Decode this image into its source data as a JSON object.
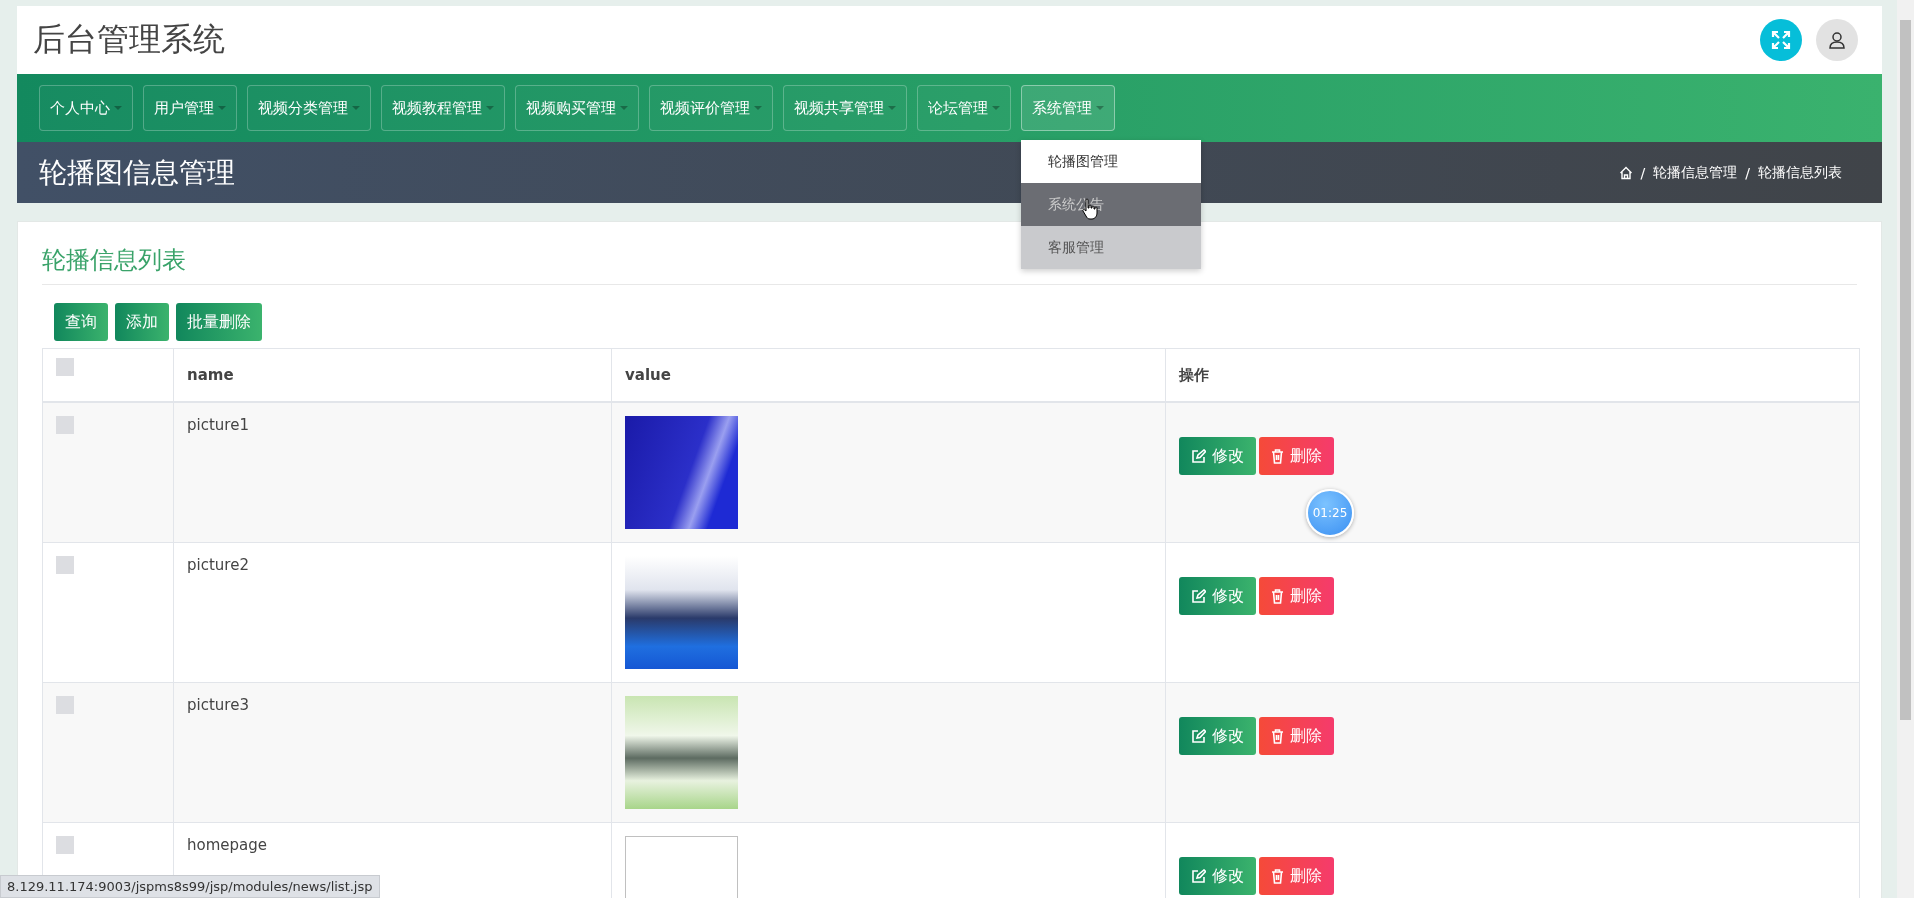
{
  "app_title": "后台管理系统",
  "nav": [
    {
      "label": "个人中心"
    },
    {
      "label": "用户管理"
    },
    {
      "label": "视频分类管理"
    },
    {
      "label": "视频教程管理"
    },
    {
      "label": "视频购买管理"
    },
    {
      "label": "视频评价管理"
    },
    {
      "label": "视频共享管理"
    },
    {
      "label": "论坛管理"
    },
    {
      "label": "系统管理",
      "expanded": true
    }
  ],
  "dropdown": [
    {
      "label": "轮播图管理",
      "kind": "current"
    },
    {
      "label": "系统公告",
      "kind": "hover"
    },
    {
      "label": "客服管理",
      "kind": "plain"
    }
  ],
  "page_title": "轮播图信息管理",
  "breadcrumb": [
    {
      "sep": "/",
      "label": "轮播信息管理"
    },
    {
      "sep": "/",
      "label": "轮播信息列表"
    }
  ],
  "card_title": "轮播信息列表",
  "toolbar": [
    "查询",
    "添加",
    "批量删除"
  ],
  "table": {
    "columns": [
      "name",
      "value",
      "操作"
    ],
    "header_checked": false,
    "rows": [
      {
        "checked": false,
        "name": "picture1",
        "kind": "photo",
        "edit": "修改",
        "delete": "删除"
      },
      {
        "checked": false,
        "name": "picture2",
        "kind": "photo",
        "edit": "修改",
        "delete": "删除"
      },
      {
        "checked": false,
        "name": "picture3",
        "kind": "photo",
        "edit": "修改",
        "delete": "删除"
      },
      {
        "checked": false,
        "name": "homepage",
        "kind": "broken",
        "edit": "修改",
        "delete": "删除"
      }
    ]
  },
  "timer": "01:25",
  "status_url": "8.129.11.174:9003/jspms8s99/jsp/modules/news/list.jsp"
}
